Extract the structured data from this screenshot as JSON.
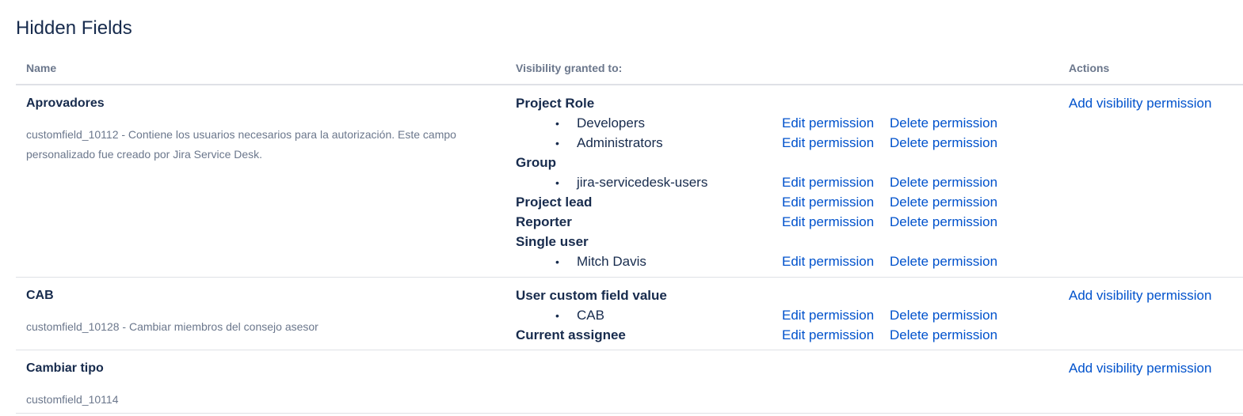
{
  "page": {
    "title": "Hidden Fields"
  },
  "table": {
    "headers": {
      "name": "Name",
      "visibility": "Visibility granted to:",
      "actions": "Actions"
    },
    "add_label": "Add visibility permission",
    "edit_label": "Edit permission",
    "delete_label": "Delete permission",
    "bullet": "•",
    "rows": [
      {
        "name": "Aprovadores",
        "description": "customfield_10112 - Contiene los usuarios necesarios para la autorización. Este campo personalizado fue creado por Jira Service Desk.",
        "lines": [
          {
            "category": "Project Role"
          },
          {
            "item": "Developers"
          },
          {
            "item": "Administrators"
          },
          {
            "category": "Group"
          },
          {
            "item": "jira-servicedesk-users"
          },
          {
            "category": "Project lead",
            "has_actions": true
          },
          {
            "category": "Reporter",
            "has_actions": true
          },
          {
            "category": "Single user"
          },
          {
            "item": "Mitch Davis"
          }
        ]
      },
      {
        "name": "CAB",
        "description": "customfield_10128 - Cambiar miembros del consejo asesor",
        "lines": [
          {
            "category": "User custom field value"
          },
          {
            "item": "CAB"
          },
          {
            "category": "Current assignee",
            "has_actions": true
          }
        ]
      },
      {
        "name": "Cambiar tipo",
        "description": "customfield_10114",
        "lines": []
      }
    ]
  }
}
